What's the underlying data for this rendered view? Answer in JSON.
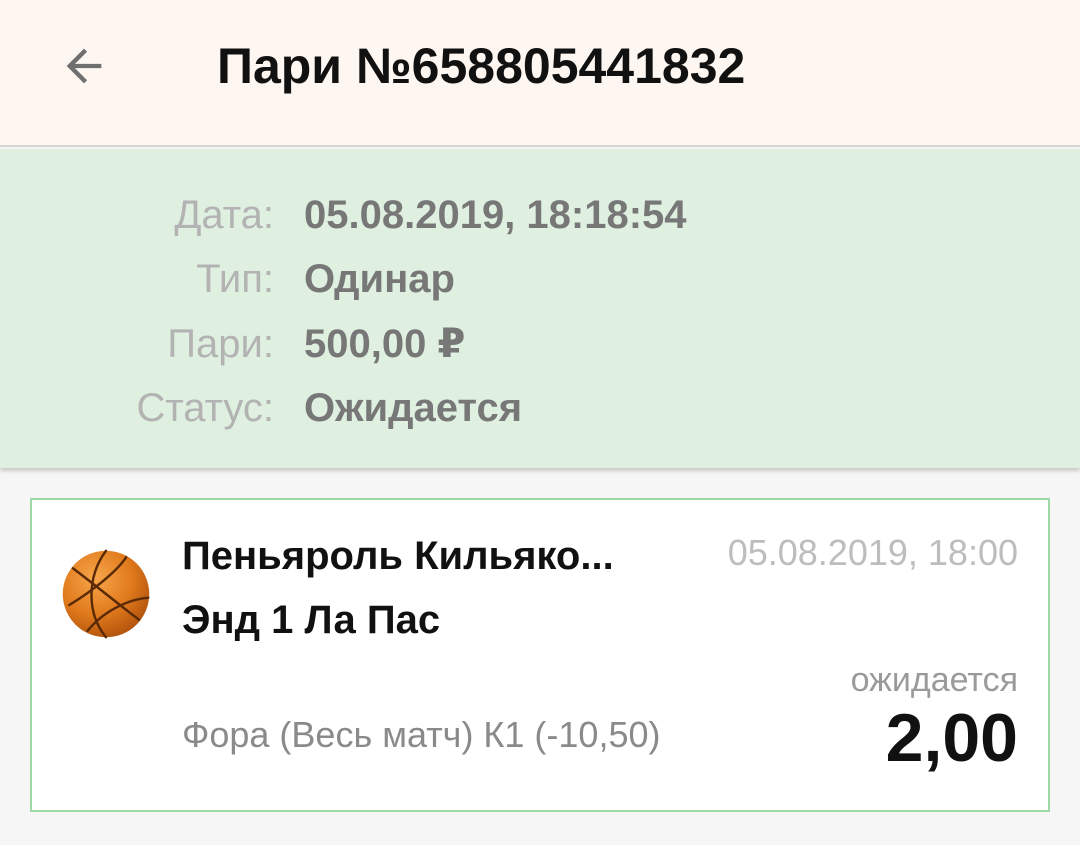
{
  "header": {
    "back_icon": "arrow-left-icon",
    "title": "Пари №658805441832"
  },
  "summary": {
    "rows": [
      {
        "label": "Дата:",
        "value": "05.08.2019, 18:18:54"
      },
      {
        "label": "Тип:",
        "value": "Одинар"
      },
      {
        "label": "Пари:",
        "value": "500,00 ₽"
      },
      {
        "label": "Статус:",
        "value": "Ожидается"
      }
    ],
    "background_color": "#dff0e1"
  },
  "event": {
    "sport_icon": "basketball-icon",
    "team1": "Пеньяроль Кильяко...",
    "team2": "Энд 1 Ла Пас",
    "date": "05.08.2019, 18:00",
    "market": "Фора (Весь матч) К1 (-10,50)",
    "status": "ожидается",
    "odds": "2,00",
    "border_color": "#9fd8a6"
  }
}
